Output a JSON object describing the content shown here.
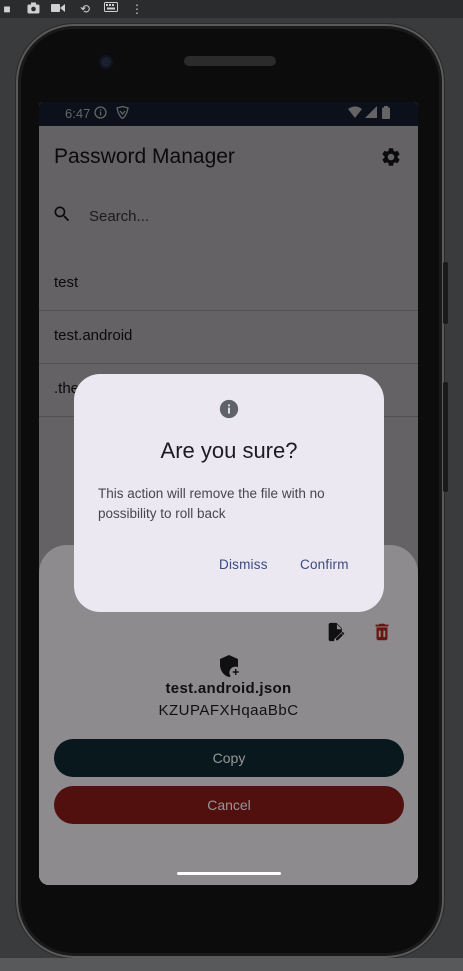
{
  "status_bar": {
    "time": "6:47",
    "icons": [
      "info-circle-icon",
      "shield-check-icon",
      "wifi-icon",
      "signal-icon",
      "battery-icon"
    ]
  },
  "app": {
    "title": "Password Manager",
    "settings_icon": "gear-icon"
  },
  "search": {
    "placeholder": "Search...",
    "value": ""
  },
  "list": {
    "items": [
      {
        "label": "test"
      },
      {
        "label": "test.android"
      },
      {
        "label": ".the"
      }
    ]
  },
  "sheet": {
    "file_name": "test.android.json",
    "password": "KZUPAFXHqaaBbC",
    "copy_label": "Copy",
    "cancel_label": "Cancel",
    "icons": [
      "edit-document-icon",
      "delete-icon",
      "shield-plus-icon"
    ]
  },
  "dialog": {
    "title": "Are you sure?",
    "body": "This action will remove the file with no possibility to roll back",
    "dismiss_label": "Dismiss",
    "confirm_label": "Confirm"
  },
  "colors": {
    "status_bar": "#1d2a45",
    "copy_button": "#0e2a33",
    "cancel_button": "#8c1d18",
    "dialog_action": "#3b4a7f",
    "dialog_bg": "#ece8f2"
  }
}
